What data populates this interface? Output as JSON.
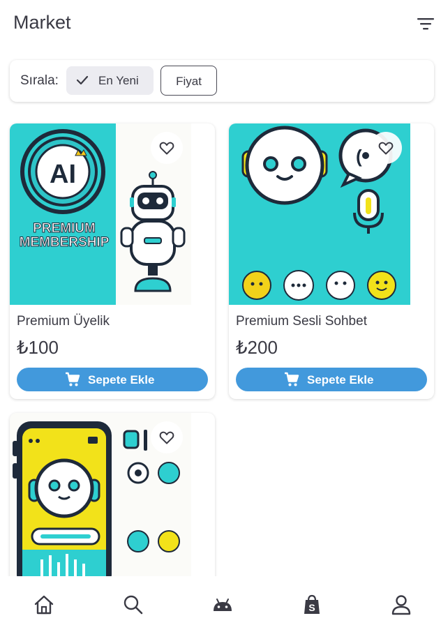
{
  "header": {
    "title": "Market",
    "filter_icon": "filter-list-icon"
  },
  "sort": {
    "label": "Sırala:",
    "options": [
      {
        "label": "En Yeni",
        "selected": true
      },
      {
        "label": "Fiyat",
        "selected": false
      }
    ]
  },
  "products": [
    {
      "title": "Premium Üyelik",
      "price": "₺100",
      "button_label": "Sepete Ekle",
      "image_text": [
        "AI",
        "PREMIUM",
        "MEMBERSHIP"
      ]
    },
    {
      "title": "Premium Sesli Sohbet",
      "price": "₺200",
      "button_label": "Sepete Ekle"
    },
    {
      "title": "",
      "price": "",
      "button_label": ""
    }
  ],
  "bottom_nav": {
    "items": [
      {
        "icon": "home-icon"
      },
      {
        "icon": "search-icon"
      },
      {
        "icon": "android-icon"
      },
      {
        "icon": "shop-bag-icon"
      },
      {
        "icon": "profile-icon"
      }
    ]
  },
  "colors": {
    "accent": "#4299dc",
    "teal": "#2ecfd0",
    "yellow": "#f2e21a",
    "text": "#3a3a44"
  }
}
